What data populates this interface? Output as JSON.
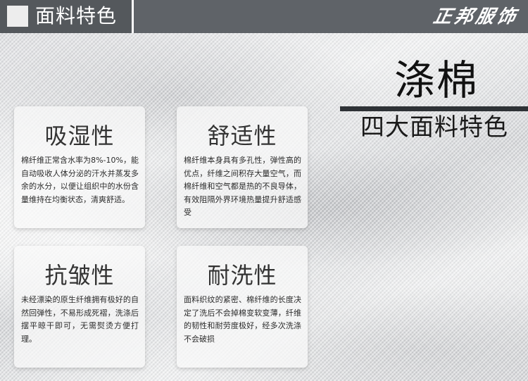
{
  "header": {
    "title": "面料特色",
    "brand": "正邦服饰"
  },
  "hero": {
    "title": "涤棉",
    "subtitle": "四大面料特色"
  },
  "features": [
    {
      "title": "吸湿性",
      "text": "棉纤维正常含水率为8%-10%，能自动吸收人体分泌的汗水并蒸发多余的水分，以便让组织中的水份含量维持在均衡状态，清爽舒适。"
    },
    {
      "title": "舒适性",
      "text": "棉纤维本身具有多孔性，弹性高的优点，纤维之间积存大量空气，而棉纤维和空气都是热的不良导体，有效阻隔外界环境热量提升舒适感受"
    },
    {
      "title": "抗皱性",
      "text": "未经漂染的原生纤维拥有极好的自然回弹性，不易形成死褶，洗涤后摆平晾干即可，无需熨烫方便打理。"
    },
    {
      "title": "耐洗性",
      "text": "面料织纹的紧密、棉纤维的长度决定了洗后不会掉棉变软变薄，纤维的韧性和耐劳度极好，经多次洗涤不会破损"
    }
  ],
  "colors": {
    "header_bg": "#5f6368",
    "accent_bar": "#2e3236"
  }
}
